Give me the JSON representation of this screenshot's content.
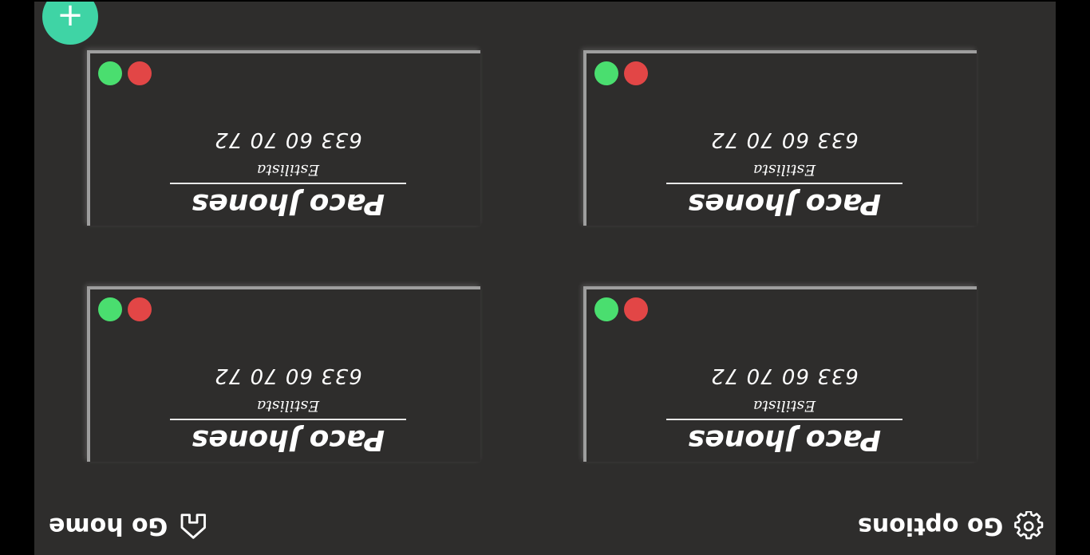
{
  "add_button": {
    "label": "+"
  },
  "cards": [
    {
      "name": "Paco Jhones",
      "role": "Estilista",
      "phone": "633 60 70 72"
    },
    {
      "name": "Paco Jhones",
      "role": "Estilista",
      "phone": "633 60 70 72"
    },
    {
      "name": "Paco Jhones",
      "role": "Estilista",
      "phone": "633 60 70 72"
    },
    {
      "name": "Paco Jhones",
      "role": "Estilista",
      "phone": "633 60 70 72"
    }
  ],
  "footer": {
    "home_label": "Go home",
    "home_icon": "home-icon",
    "options_label": "Go options",
    "options_icon": "gear-icon"
  },
  "colors": {
    "background": "#2e2d2c",
    "accent": "#3fd4a5",
    "confirm_dot": "#4ade6f",
    "delete_dot": "#e24646"
  }
}
